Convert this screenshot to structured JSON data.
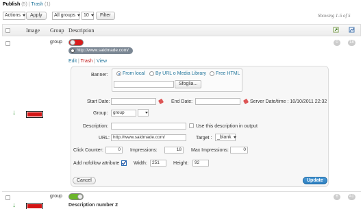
{
  "views": {
    "publish_label": "Publish",
    "publish_count": "(5)",
    "separator": "|",
    "trash_label": "Trash",
    "trash_count": "(1)"
  },
  "toolbar": {
    "actions_label": "Actions",
    "apply_label": "Apply",
    "groups_label": "All groups",
    "per_page_value": "10",
    "filter_label": "Filter",
    "showing_text": "Showing 1-5 of 5"
  },
  "table": {
    "headers": {
      "image": "Image",
      "group": "Group",
      "description": "Description"
    }
  },
  "row1": {
    "group": "group",
    "url_pill": "http://www.saidmade.com/",
    "actions": {
      "edit": "Edit",
      "trash": "Trash",
      "view": "View",
      "sep": "|"
    },
    "stat_a": "0",
    "stat_b": "18",
    "toggle_state": "off"
  },
  "form": {
    "banner_label": "Banner:",
    "radio_local": "From local",
    "radio_url": "By URL o Media Library",
    "radio_html": "Free HTML",
    "browse_label": "Sfoglia...",
    "start_date_label": "Start Date:",
    "end_date_label": "End Date:",
    "server_date": "Server Date/time : 10/10/2011 22:32",
    "group_label": "Group:",
    "group_value": "group",
    "description_label": "Description:",
    "use_description_label": "Use this description in output",
    "url_label": "URL:",
    "url_value": "http://www.saidmade.com/",
    "target_label": "Target :",
    "target_value": "_blank",
    "click_counter_label": "Click Counter:",
    "click_counter_value": "0",
    "impressions_label": "Impressions:",
    "impressions_value": "18",
    "max_impressions_label": "Max Impressions:",
    "max_impressions_value": "0",
    "nofollow_label": "Add nofollow attribute",
    "width_label": "Width:",
    "width_value": "251",
    "height_label": "Height:",
    "height_value": "92",
    "cancel_label": "Cancel",
    "update_label": "Update"
  },
  "row2": {
    "group": "group",
    "description": "Description number 2",
    "stat_a": "6",
    "stat_b": "41",
    "toggle_state": "on"
  },
  "colors": {
    "link": "#21759b",
    "update_button": "#2e7fc0",
    "toggle_off": "#d91c1c",
    "toggle_on": "#6bb52a",
    "banner_red": "#d31515"
  }
}
